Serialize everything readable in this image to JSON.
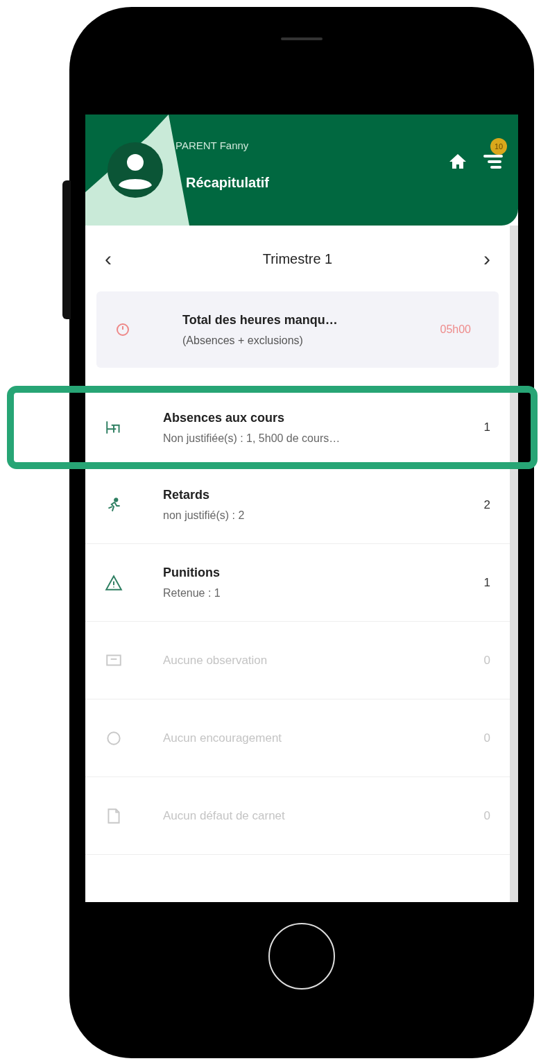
{
  "header": {
    "user_name": "PARENT Fanny",
    "title": "Récapitulatif",
    "notification_count": "10"
  },
  "period": {
    "label": "Trimestre 1",
    "prev": "‹",
    "next": "›"
  },
  "summary": {
    "title": "Total des heures manqu…",
    "subtitle": "(Absences + exclusions)",
    "value": "05h00"
  },
  "items": [
    {
      "kind": "absence",
      "title": "Absences aux cours",
      "subtitle": "Non justifiée(s) : 1, 5h00 de cours…",
      "count": "1",
      "disabled": false,
      "highlighted": true
    },
    {
      "kind": "late",
      "title": "Retards",
      "subtitle": "non justifié(s) : 2",
      "count": "2",
      "disabled": false,
      "highlighted": false
    },
    {
      "kind": "punishment",
      "title": "Punitions",
      "subtitle": "Retenue : 1",
      "count": "1",
      "disabled": false,
      "highlighted": false
    },
    {
      "kind": "observation",
      "title": "Aucune observation",
      "count": "0",
      "disabled": true,
      "highlighted": false
    },
    {
      "kind": "encouragement",
      "title": "Aucun encouragement",
      "count": "0",
      "disabled": true,
      "highlighted": false
    },
    {
      "kind": "notebook",
      "title": "Aucun défaut de carnet",
      "count": "0",
      "disabled": true,
      "highlighted": false
    }
  ]
}
